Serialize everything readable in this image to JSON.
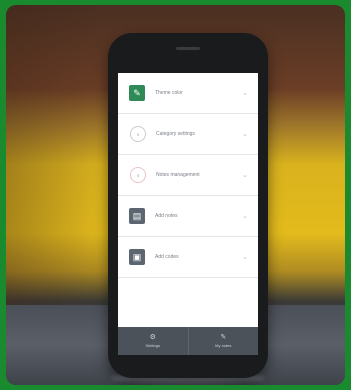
{
  "colors": {
    "border_green": "#1a8a2e",
    "accent_green": "#2e8b57",
    "slate_icon": "#5c6670",
    "tabbar": "#4b5259"
  },
  "rows": [
    {
      "label": "Theme color",
      "icon": "square-icon-green"
    },
    {
      "label": "Category settings",
      "icon": "circle-icon"
    },
    {
      "label": "Notes management",
      "icon": "circle-icon"
    },
    {
      "label": "Add notes",
      "icon": "square-icon-slate"
    },
    {
      "label": "Add codes",
      "icon": "square-icon-slate"
    }
  ],
  "tabs": [
    {
      "label": "Settings",
      "icon": "gear-icon"
    },
    {
      "label": "My notes",
      "icon": "note-icon"
    }
  ]
}
